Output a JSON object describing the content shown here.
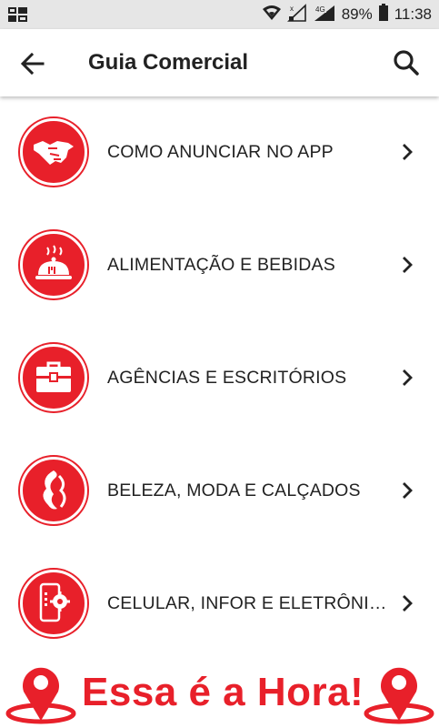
{
  "status": {
    "battery": "89%",
    "time": "11:38",
    "network": "4G"
  },
  "header": {
    "title": "Guia Comercial",
    "back_icon": "arrow-left-icon",
    "search_icon": "search-icon"
  },
  "categories": [
    {
      "label": "COMO ANUNCIAR NO APP",
      "icon": "handshake-icon"
    },
    {
      "label": "ALIMENTAÇÃO E BEBIDAS",
      "icon": "food-cloche-icon"
    },
    {
      "label": "AGÊNCIAS E ESCRITÓRIOS",
      "icon": "briefcase-icon"
    },
    {
      "label": "BELEZA, MODA E CALÇADOS",
      "icon": "hair-beauty-icon"
    },
    {
      "label": "CELULAR, INFOR E ELETRÔNICOS",
      "icon": "phone-gear-icon"
    }
  ],
  "banner": {
    "text": "Essa é a Hora!",
    "icon": "map-pin-icon"
  },
  "colors": {
    "accent": "#e8202a",
    "statusbar": "#e6e6e6",
    "text": "#222222"
  }
}
